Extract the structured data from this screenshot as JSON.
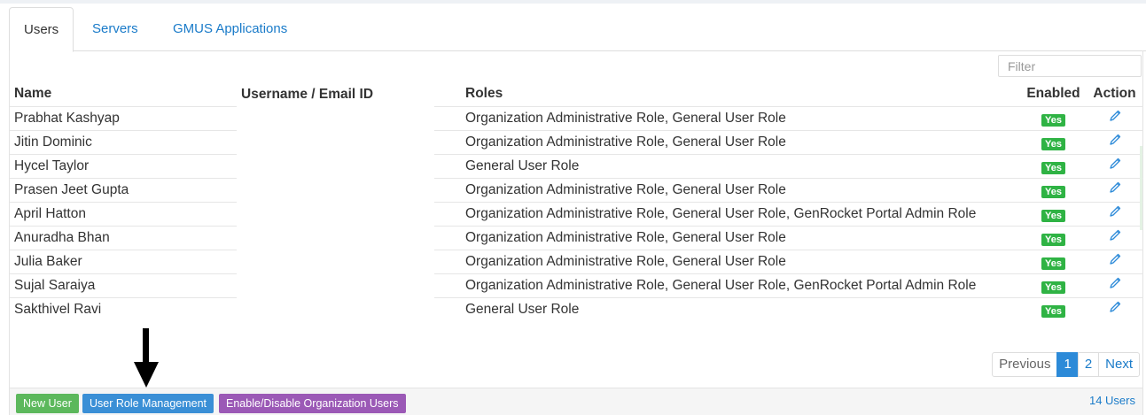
{
  "tabs": [
    {
      "label": "Users",
      "active": true
    },
    {
      "label": "Servers",
      "active": false
    },
    {
      "label": "GMUS Applications",
      "active": false
    }
  ],
  "filter": {
    "placeholder": "Filter",
    "value": ""
  },
  "table": {
    "columns": [
      "Name",
      "Username / Email ID",
      "Roles",
      "Enabled",
      "Action"
    ],
    "rows": [
      {
        "name": "Prabhat Kashyap",
        "email": "",
        "roles": "Organization Administrative Role, General User Role",
        "enabled": "Yes"
      },
      {
        "name": "Jitin Dominic",
        "email": "",
        "roles": "Organization Administrative Role, General User Role",
        "enabled": "Yes"
      },
      {
        "name": "Hycel Taylor",
        "email": "",
        "roles": "General User Role",
        "enabled": "Yes"
      },
      {
        "name": "Prasen Jeet Gupta",
        "email": "",
        "roles": "Organization Administrative Role, General User Role",
        "enabled": "Yes"
      },
      {
        "name": "April Hatton",
        "email": "",
        "roles": "Organization Administrative Role, General User Role, GenRocket Portal Admin Role",
        "enabled": "Yes"
      },
      {
        "name": "Anuradha Bhan",
        "email": "",
        "roles": "Organization Administrative Role, General User Role",
        "enabled": "Yes"
      },
      {
        "name": "Julia Baker",
        "email": "",
        "roles": "Organization Administrative Role, General User Role",
        "enabled": "Yes"
      },
      {
        "name": "Sujal Saraiya",
        "email": "",
        "roles": "Organization Administrative Role, General User Role, GenRocket Portal Admin Role",
        "enabled": "Yes"
      },
      {
        "name": "Sakthivel Ravi",
        "email": "",
        "roles": "General User Role",
        "enabled": "Yes"
      }
    ]
  },
  "pagination": {
    "previous": "Previous",
    "pages": [
      "1",
      "2"
    ],
    "current": "1",
    "next": "Next"
  },
  "footer": {
    "new_user": "New User",
    "role_mgmt": "User Role Management",
    "enable_disable": "Enable/Disable Organization Users",
    "count": "14 Users"
  },
  "colors": {
    "link": "#1a7bc9",
    "badge_green": "#2fb344",
    "btn_green": "#5cb85c",
    "btn_blue": "#3a8fd6",
    "btn_purple": "#9b59b6"
  },
  "icons": {
    "edit": "pencil-icon",
    "annotation": "down-arrow-icon"
  }
}
